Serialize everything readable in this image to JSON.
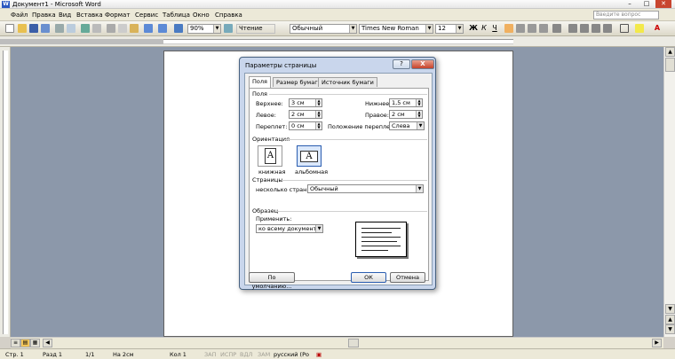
{
  "window": {
    "title": "Документ1 - Microsoft Word"
  },
  "menu": [
    "Файл",
    "Правка",
    "Вид",
    "Вставка",
    "Формат",
    "Сервис",
    "Таблица",
    "Окно",
    "Справка"
  ],
  "help_box": {
    "placeholder": "Введите вопрос"
  },
  "toolbar": {
    "zoom": "90%",
    "reading": "Чтение",
    "style": "Обычный",
    "font": "Times New Roman",
    "size": "12"
  },
  "dialog": {
    "title": "Параметры страницы",
    "help_btn": "?",
    "close_btn": "X",
    "tabs": [
      "Поля",
      "Размер бумаги",
      "Источник бумаги"
    ],
    "margins": {
      "section": "Поля",
      "top_label": "Верхнее:",
      "top_value": "3 см",
      "bottom_label": "Нижнее:",
      "bottom_value": "1,5 см",
      "left_label": "Левое:",
      "left_value": "2 см",
      "right_label": "Правое:",
      "right_value": "2 см",
      "gutter_label": "Переплет:",
      "gutter_value": "0 см",
      "gutter_pos_label": "Положение переплета:",
      "gutter_pos_value": "Слева"
    },
    "orientation": {
      "section": "Ориентация",
      "portrait": "книжная",
      "landscape": "альбомная",
      "selected": "альбомная"
    },
    "pages": {
      "section": "Страницы",
      "label": "несколько страниц:",
      "value": "Обычный"
    },
    "sample": {
      "section": "Образец",
      "apply_label": "Применить:",
      "apply_value": "ко всему документу"
    },
    "buttons": {
      "default": "По умолчанию...",
      "ok": "ОК",
      "cancel": "Отмена"
    }
  },
  "status": {
    "page": "Стр. 1",
    "section": "Разд 1",
    "pages": "1/1",
    "at": "На 2см",
    "col": "Кол 1",
    "rec": "ЗАП",
    "trk": "ИСПР",
    "ext": "ВДЛ",
    "ovr": "ЗАМ",
    "lang": "русский (Ро"
  }
}
